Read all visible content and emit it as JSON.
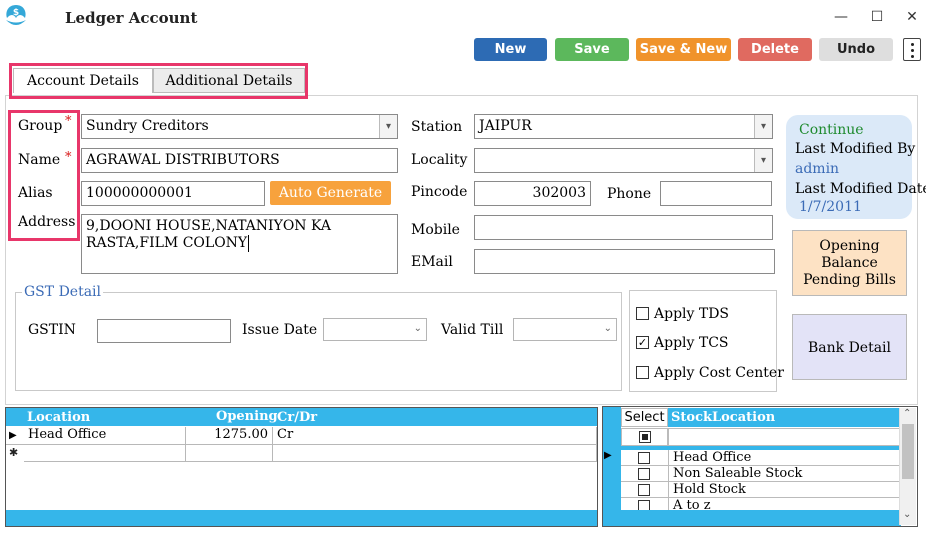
{
  "window": {
    "title": "Ledger Account",
    "min": "—",
    "max": "☐",
    "close": "✕"
  },
  "toolbar": [
    {
      "label": "New",
      "color": "#2d6bb4"
    },
    {
      "label": "Save",
      "color": "#5cb85c"
    },
    {
      "label": "Save & New",
      "color": "#f0932b"
    },
    {
      "label": "Delete",
      "color": "#e06a60"
    },
    {
      "label": "Undo",
      "color": "#dedede"
    }
  ],
  "tabs": {
    "account": "Account Details",
    "additional": "Additional Details"
  },
  "form": {
    "group_label": "Group",
    "group_value": "Sundry Creditors",
    "name_label": "Name",
    "name_value": "AGRAWAL DISTRIBUTORS",
    "alias_label": "Alias",
    "alias_value": "100000000001",
    "address_label": "Address",
    "address_line1": "9,DOONI HOUSE,NATANIYON KA",
    "address_line2": "RASTA,FILM COLONY",
    "auto_generate": "Auto Generate",
    "required_mark": "*",
    "station_label": "Station",
    "station_value": "JAIPUR",
    "locality_label": "Locality",
    "locality_value": "",
    "pincode_label": "Pincode",
    "pincode_value": "302003",
    "phone_label": "Phone",
    "phone_value": "",
    "mobile_label": "Mobile",
    "mobile_value": "",
    "email_label": "EMail",
    "email_value": ""
  },
  "info": {
    "continue": "Continue",
    "last_modified_by_label": "Last Modified By",
    "last_modified_by": "admin",
    "last_modified_date_label": "Last Modified Date",
    "last_modified_date": "1/7/2011"
  },
  "side_buttons": {
    "opening_1": "Opening",
    "opening_2": "Balance",
    "opening_3": "Pending Bills",
    "bank": "Bank Detail"
  },
  "gst": {
    "title": "GST Detail",
    "gstin_label": "GSTIN",
    "gstin_value": "",
    "issue_date_label": "Issue Date",
    "valid_till_label": "Valid Till"
  },
  "options": {
    "tds": {
      "label": "Apply TDS",
      "checked": false
    },
    "tcs": {
      "label": "Apply TCS",
      "checked": true
    },
    "cost_center": {
      "label": "Apply Cost Center",
      "checked": false
    }
  },
  "location_grid": {
    "headers": [
      "Location",
      "Opening",
      "Cr/Dr"
    ],
    "rows": [
      {
        "location": "Head Office",
        "opening": "1275.00",
        "crdr": "Cr"
      }
    ],
    "new_row_marker": "✱"
  },
  "stock_grid": {
    "headers": [
      "Select",
      "StockLocation"
    ],
    "rows": [
      "Head Office",
      "Non Saleable Stock",
      "Hold Stock",
      "A to z"
    ]
  },
  "colors": {
    "accent": "#35b6ea",
    "highlight": "#e8366a",
    "continue": "#1e8a2e",
    "link": "#3b6bb6"
  }
}
